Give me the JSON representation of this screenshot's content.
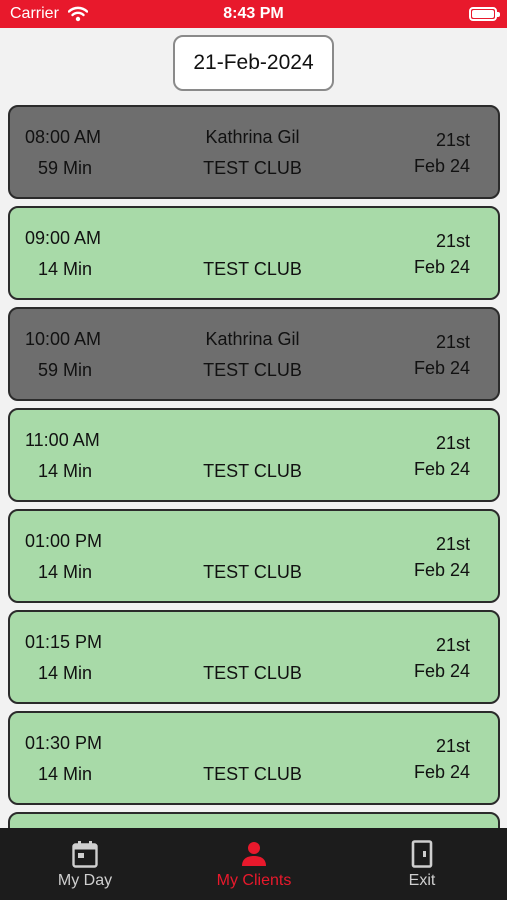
{
  "status": {
    "carrier": "Carrier",
    "time": "8:43 PM"
  },
  "selected_date": "21-Feb-2024",
  "appointments": [
    {
      "time": "08:00 AM",
      "duration": "59 Min",
      "client": "Kathrina Gil",
      "club": "TEST CLUB",
      "day": "21st",
      "month": "Feb 24",
      "status": "booked"
    },
    {
      "time": "09:00 AM",
      "duration": "14 Min",
      "client": "",
      "club": "TEST CLUB",
      "day": "21st",
      "month": "Feb 24",
      "status": "free"
    },
    {
      "time": "10:00 AM",
      "duration": "59 Min",
      "client": "Kathrina Gil",
      "club": "TEST CLUB",
      "day": "21st",
      "month": "Feb 24",
      "status": "booked"
    },
    {
      "time": "11:00 AM",
      "duration": "14 Min",
      "client": "",
      "club": "TEST CLUB",
      "day": "21st",
      "month": "Feb 24",
      "status": "free"
    },
    {
      "time": "01:00 PM",
      "duration": "14 Min",
      "client": "",
      "club": "TEST CLUB",
      "day": "21st",
      "month": "Feb 24",
      "status": "free"
    },
    {
      "time": "01:15 PM",
      "duration": "14 Min",
      "client": "",
      "club": "TEST CLUB",
      "day": "21st",
      "month": "Feb 24",
      "status": "free"
    },
    {
      "time": "01:30 PM",
      "duration": "14 Min",
      "client": "",
      "club": "TEST CLUB",
      "day": "21st",
      "month": "Feb 24",
      "status": "free"
    },
    {
      "time": "",
      "duration": "",
      "client": "",
      "club": "",
      "day": "",
      "month": "",
      "status": "free"
    }
  ],
  "tabs": [
    {
      "label": "My Day",
      "icon": "calendar-icon",
      "active": false
    },
    {
      "label": "My Clients",
      "icon": "person-icon",
      "active": true
    },
    {
      "label": "Exit",
      "icon": "door-icon",
      "active": false
    }
  ],
  "colors": {
    "accent": "#e8192c",
    "booked": "#6e6e6e",
    "free": "#a8daa8",
    "tab_bar": "#1c1c1c"
  }
}
